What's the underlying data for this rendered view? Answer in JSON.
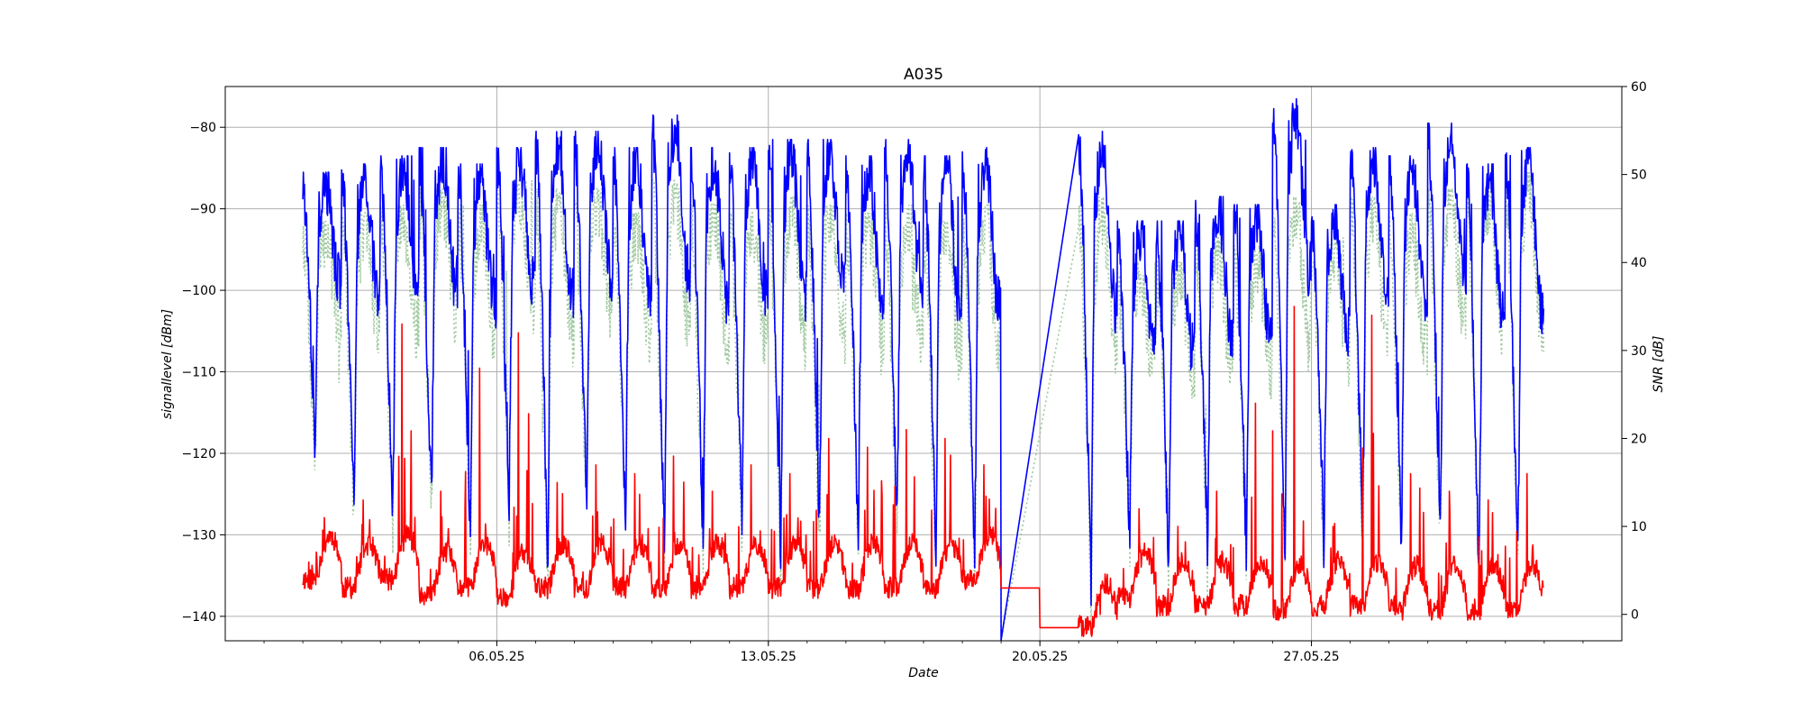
{
  "chart_data": {
    "type": "line",
    "title": "A035",
    "xlabel": "Date",
    "ylabel_left": "signallevel [dBm]",
    "ylabel_right": "SNR [dB]",
    "grid": true,
    "x_start": "2025-05-01",
    "x_end": "2025-06-02",
    "xlim": [
      "2025-04-29",
      "2025-06-04"
    ],
    "x_ticks": [
      "06.05.25",
      "13.05.25",
      "20.05.25",
      "27.05.25"
    ],
    "y_left_lim": [
      -143,
      -75
    ],
    "y_left_ticks": [
      -80,
      -90,
      -100,
      -110,
      -120,
      -130,
      -140
    ],
    "y_right_lim": [
      -3,
      60
    ],
    "y_right_ticks": [
      60,
      50,
      40,
      30,
      20,
      10,
      0
    ],
    "data_gap": [
      "2025-05-19",
      "2025-05-21"
    ],
    "series": [
      {
        "axis": "left",
        "color": "#0000ff",
        "style": "solid",
        "daily_peak": [
          -87,
          -86,
          -85,
          -84,
          -86,
          -84,
          -82,
          -82,
          -84,
          -80,
          -84,
          -84,
          -83,
          -83,
          -85,
          -83,
          -85,
          -84,
          -85,
          -86,
          -82,
          -93,
          -93,
          -90,
          -91,
          -78,
          -91,
          -84,
          -85,
          -81,
          -86,
          -84
        ],
        "daily_trough": [
          -120,
          -127,
          -128,
          -127,
          -130,
          -126,
          -134,
          -127,
          -128,
          -132,
          -131,
          -130,
          -132,
          -130,
          -131,
          -129,
          -132,
          -133,
          -135,
          -135,
          -137,
          -130,
          -133,
          -132,
          -131,
          -133,
          -131,
          -130,
          -132,
          -130,
          -135,
          -134
        ]
      },
      {
        "axis": "left",
        "color": "#8fbf8f",
        "style": "dotted",
        "daily_peak": [
          -93,
          -92,
          -91,
          -89,
          -91,
          -88,
          -89,
          -89,
          -92,
          -88,
          -91,
          -92,
          -90,
          -91,
          -92,
          -91,
          -93,
          -91,
          -92,
          -93,
          -90,
          -98,
          -98,
          -95,
          -96,
          -90,
          -95,
          -90,
          -92,
          -89,
          -88,
          -87
        ],
        "daily_trough": [
          -122,
          -127,
          -129,
          -126,
          -130,
          -127,
          -135,
          -127,
          -128,
          -132,
          -132,
          -130,
          -133,
          -131,
          -132,
          -130,
          -134,
          -134,
          -137,
          -139,
          -139,
          -131,
          -134,
          -133,
          -132,
          -134,
          -132,
          -131,
          -133,
          -131,
          -138,
          -135
        ]
      },
      {
        "axis": "right",
        "color": "#ff0000",
        "style": "solid",
        "daily_spike": [
          11,
          13,
          33,
          14,
          28,
          32,
          15,
          17,
          16,
          18,
          14,
          17,
          16,
          20,
          19,
          21,
          20,
          17,
          11,
          0,
          0,
          12,
          10,
          14,
          24,
          35,
          10,
          34,
          16,
          14,
          13,
          16
        ],
        "daily_base": [
          4,
          3,
          4,
          2,
          3,
          2,
          3,
          3,
          3,
          3,
          3,
          3,
          3,
          3,
          3,
          3,
          3,
          4,
          3,
          -1.5,
          -1.5,
          2,
          1,
          1,
          1,
          0.5,
          1,
          1,
          0.5,
          0.5,
          0.5,
          0.5
        ]
      }
    ]
  }
}
